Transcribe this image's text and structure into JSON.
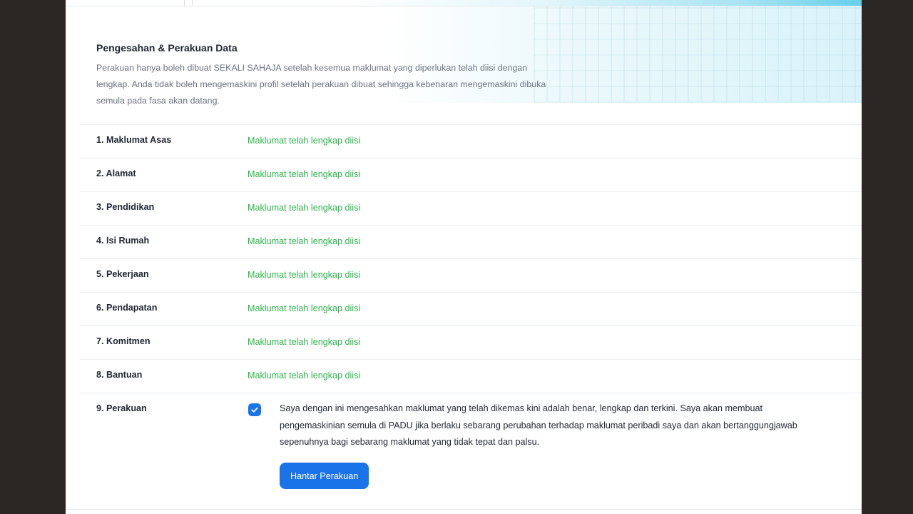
{
  "section": {
    "title": "Pengesahan & Perakuan Data",
    "description": "Perakuan hanya boleh dibuat SEKALI SAHAJA setelah kesemua maklumat yang diperlukan telah diisi dengan lengkap. Anda tidak boleh mengemaskini profil setelah perakuan dibuat sehingga kebenaran mengemaskini dibuka semula pada fasa akan datang."
  },
  "rows": [
    {
      "label": "1. Maklumat Asas",
      "status": "Maklumat telah lengkap diisi"
    },
    {
      "label": "2. Alamat",
      "status": "Maklumat telah lengkap diisi"
    },
    {
      "label": "3. Pendidikan",
      "status": "Maklumat telah lengkap diisi"
    },
    {
      "label": "4. Isi Rumah",
      "status": "Maklumat telah lengkap diisi"
    },
    {
      "label": "5. Pekerjaan",
      "status": "Maklumat telah lengkap diisi"
    },
    {
      "label": "6. Pendapatan",
      "status": "Maklumat telah lengkap diisi"
    },
    {
      "label": "7. Komitmen",
      "status": "Maklumat telah lengkap diisi"
    },
    {
      "label": "8. Bantuan",
      "status": "Maklumat telah lengkap diisi"
    }
  ],
  "declaration": {
    "label": "9. Perakuan",
    "checked": true,
    "text": "Saya dengan ini mengesahkan maklumat yang telah dikemas kini adalah benar, lengkap dan terkini. Saya akan membuat pengemaskinian semula di PADU jika berlaku sebarang perubahan terhadap maklumat peribadi saya dan akan bertanggungjawab sepenuhnya bagi sebarang maklumat yang tidak tepat dan palsu.",
    "submit_label": "Hantar Perakuan"
  },
  "colors": {
    "success": "#2bb54a",
    "primary": "#1a73e8"
  },
  "icons": {
    "checkbox": "check-icon"
  }
}
